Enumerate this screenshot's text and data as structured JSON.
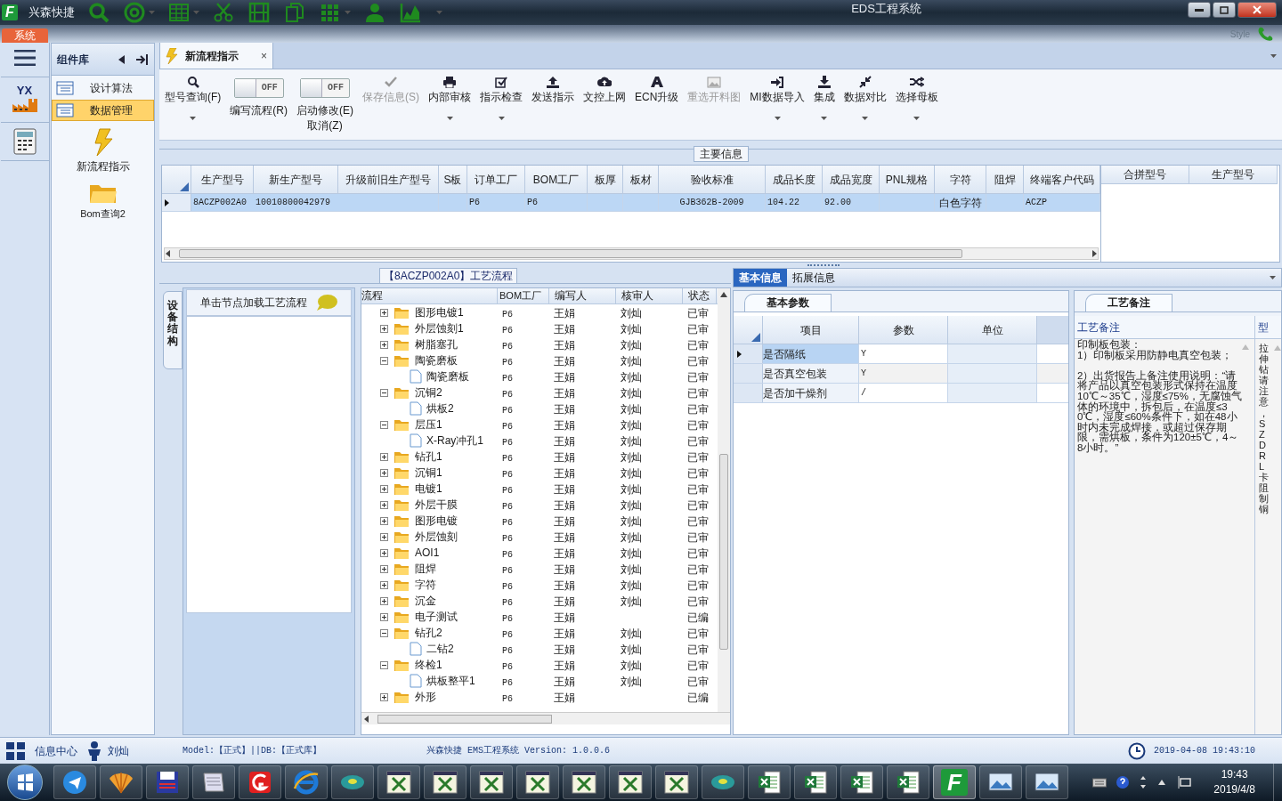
{
  "title_bar": {
    "logo": "F",
    "app_name": "兴森快捷",
    "title": "EDS工程系统"
  },
  "ribbon": {
    "tab": "系统",
    "style_label": "Style"
  },
  "left_rail": {
    "logo_text": "YX"
  },
  "sidebar": {
    "title": "组件库",
    "items": [
      {
        "label": "设计算法",
        "selected": false
      },
      {
        "label": "数据管理",
        "selected": true
      }
    ],
    "launchers": [
      {
        "label": "新流程指示"
      },
      {
        "label": "Bom查询2"
      }
    ]
  },
  "document_tab": {
    "title": "新流程指示",
    "close": "×"
  },
  "toolbar": [
    {
      "kind": "button",
      "lines": [
        "型号查询(F)"
      ],
      "disabled": false,
      "dropdown": true
    },
    {
      "kind": "toggle",
      "lines": [
        "编写流程(R)"
      ],
      "state_text": "OFF",
      "on": false
    },
    {
      "kind": "toggle",
      "lines": [
        "启动修改(E)",
        "取消(Z)"
      ],
      "state_text": "OFF",
      "on": false
    },
    {
      "kind": "button",
      "lines": [
        "保存信息(S)"
      ],
      "disabled": true,
      "dropdown": false
    },
    {
      "kind": "button",
      "lines": [
        "内部审核"
      ],
      "disabled": false,
      "dropdown": true
    },
    {
      "kind": "button",
      "lines": [
        "指示检查"
      ],
      "disabled": false,
      "dropdown": true
    },
    {
      "kind": "button",
      "lines": [
        "发送指示"
      ],
      "disabled": false,
      "dropdown": false
    },
    {
      "kind": "button",
      "lines": [
        "文控上网"
      ],
      "disabled": false,
      "dropdown": false
    },
    {
      "kind": "button",
      "lines": [
        "ECN升级"
      ],
      "disabled": false,
      "dropdown": false
    },
    {
      "kind": "button",
      "lines": [
        "重选开料图"
      ],
      "disabled": true,
      "dropdown": false
    },
    {
      "kind": "button",
      "lines": [
        "MI数据导入"
      ],
      "disabled": false,
      "dropdown": true
    },
    {
      "kind": "button",
      "lines": [
        "集成"
      ],
      "disabled": false,
      "dropdown": true
    },
    {
      "kind": "button",
      "lines": [
        "数据对比"
      ],
      "disabled": false,
      "dropdown": true
    },
    {
      "kind": "button",
      "lines": [
        "选择母板"
      ],
      "disabled": false,
      "dropdown": true
    }
  ],
  "main_info": {
    "title": "主要信息",
    "columns": [
      "生产型号",
      "新生产型号",
      "升级前旧生产型号",
      "S板",
      "订单工厂",
      "BOM工厂",
      "板厚",
      "板材",
      "验收标准",
      "成品长度",
      "成品宽度",
      "PNL规格",
      "字符",
      "阻焊",
      "终端客户代码"
    ],
    "rows": [
      {
        "selected": true,
        "cells": [
          "8ACZP002A0",
          "10010800042979",
          null,
          null,
          "P6",
          "P6",
          null,
          null,
          "GJB362B-2009",
          "104.22",
          "92.00",
          null,
          "白色字符",
          null,
          "ACZP"
        ]
      }
    ],
    "side_columns": [
      "合拼型号",
      "生产型号"
    ]
  },
  "process": {
    "title": "【8ACZP002A0】工艺流程",
    "side_tab": "设备结构",
    "hint": "单击节点加载工艺流程",
    "columns": [
      "流程",
      "BOM工厂",
      "编写人",
      "核审人",
      "状态"
    ],
    "nodes": [
      {
        "name": "图形电镀1",
        "bom": "P6",
        "author": "王娟",
        "reviewer": "刘灿",
        "status": "已审",
        "expanded": false
      },
      {
        "name": "外层蚀刻1",
        "bom": "P6",
        "author": "王娟",
        "reviewer": "刘灿",
        "status": "已审",
        "expanded": false
      },
      {
        "name": "树脂塞孔",
        "bom": "P6",
        "author": "王娟",
        "reviewer": "刘灿",
        "status": "已审",
        "expanded": false
      },
      {
        "name": "陶瓷磨板",
        "bom": "P6",
        "author": "王娟",
        "reviewer": "刘灿",
        "status": "已审",
        "expanded": true,
        "children": [
          {
            "name": "陶瓷磨板",
            "bom": "P6",
            "author": "王娟",
            "reviewer": "刘灿",
            "status": "已审"
          }
        ]
      },
      {
        "name": "沉铜2",
        "bom": "P6",
        "author": "王娟",
        "reviewer": "刘灿",
        "status": "已审",
        "expanded": true,
        "children": [
          {
            "name": "烘板2",
            "bom": "P6",
            "author": "王娟",
            "reviewer": "刘灿",
            "status": "已审"
          }
        ]
      },
      {
        "name": "层压1",
        "bom": "P6",
        "author": "王娟",
        "reviewer": "刘灿",
        "status": "已审",
        "expanded": true,
        "children": [
          {
            "name": "X-Ray冲孔1",
            "bom": "P6",
            "author": "王娟",
            "reviewer": "刘灿",
            "status": "已审"
          }
        ]
      },
      {
        "name": "钻孔1",
        "bom": "P6",
        "author": "王娟",
        "reviewer": "刘灿",
        "status": "已审",
        "expanded": false
      },
      {
        "name": "沉铜1",
        "bom": "P6",
        "author": "王娟",
        "reviewer": "刘灿",
        "status": "已审",
        "expanded": false
      },
      {
        "name": "电镀1",
        "bom": "P6",
        "author": "王娟",
        "reviewer": "刘灿",
        "status": "已审",
        "expanded": false
      },
      {
        "name": "外层干膜",
        "bom": "P6",
        "author": "王娟",
        "reviewer": "刘灿",
        "status": "已审",
        "expanded": false
      },
      {
        "name": "图形电镀",
        "bom": "P6",
        "author": "王娟",
        "reviewer": "刘灿",
        "status": "已审",
        "expanded": false
      },
      {
        "name": "外层蚀刻",
        "bom": "P6",
        "author": "王娟",
        "reviewer": "刘灿",
        "status": "已审",
        "expanded": false
      },
      {
        "name": "AOI1",
        "bom": "P6",
        "author": "王娟",
        "reviewer": "刘灿",
        "status": "已审",
        "expanded": false
      },
      {
        "name": "阻焊",
        "bom": "P6",
        "author": "王娟",
        "reviewer": "刘灿",
        "status": "已审",
        "expanded": false
      },
      {
        "name": "字符",
        "bom": "P6",
        "author": "王娟",
        "reviewer": "刘灿",
        "status": "已审",
        "expanded": false
      },
      {
        "name": "沉金",
        "bom": "P6",
        "author": "王娟",
        "reviewer": "刘灿",
        "status": "已审",
        "expanded": false
      },
      {
        "name": "电子测试",
        "bom": "P6",
        "author": "王娟",
        "status": "已编",
        "expanded": false
      },
      {
        "name": "钻孔2",
        "bom": "P6",
        "author": "王娟",
        "reviewer": "刘灿",
        "status": "已审",
        "expanded": true,
        "children": [
          {
            "name": "二钻2",
            "bom": "P6",
            "author": "王娟",
            "reviewer": "刘灿",
            "status": "已审"
          }
        ]
      },
      {
        "name": "终检1",
        "bom": "P6",
        "author": "王娟",
        "reviewer": "刘灿",
        "status": "已审",
        "expanded": true,
        "children": [
          {
            "name": "烘板整平1",
            "bom": "P6",
            "author": "王娟",
            "reviewer": "刘灿",
            "status": "已审"
          }
        ]
      },
      {
        "name": "外形",
        "bom": "P6",
        "author": "王娟",
        "status": "已编",
        "expanded": false
      }
    ]
  },
  "info_tabs": [
    {
      "label": "基本信息",
      "selected": true
    },
    {
      "label": "拓展信息",
      "selected": false
    }
  ],
  "params": {
    "tab": "基本参数",
    "columns": [
      "项目",
      "参数",
      "单位"
    ],
    "rows": [
      {
        "item": "是否隔纸",
        "value": "Y",
        "selected": true
      },
      {
        "item": "是否真空包装",
        "value": "Y",
        "selected": false
      },
      {
        "item": "是否加干燥剂",
        "value": "/",
        "selected": false
      }
    ]
  },
  "notes": {
    "tab": "工艺备注",
    "columns": [
      "工艺备注",
      "型"
    ],
    "text": "印制板包装：\n1）印制板采用防静电真空包装；\n\n2）出货报告上备注使用说明：“请将产品以真空包装形式保持在温度10℃～35℃，湿度≤75%，无腐蚀气体的环境中，拆包后，在温度≤30℃，湿度≤60%条件下，如在48小时内未完成焊接，或超过保存期限，需烘板，条件为120±5℃，4～8小时。”",
    "side_text": "拉伸钻请注意，SZDRL卡阻制铜"
  },
  "status_bar": {
    "info_center": "信息中心",
    "user": "刘灿",
    "model": "Model:【正式】||DB:【正式库】",
    "version": "兴森快捷 EMS工程系统 Version: 1.0.0.6",
    "datetime": "2019-04-08 19:43:10"
  },
  "taskbar": {
    "app_letter": "F",
    "time": "19:43",
    "date": "2019/4/8"
  }
}
